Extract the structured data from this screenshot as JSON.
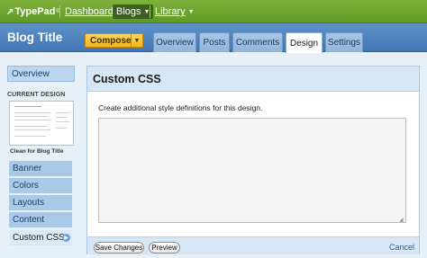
{
  "topbar": {
    "brand": "TypePad",
    "brand_mark": "↗",
    "registered": "®",
    "dashboard": "Dashboard",
    "blogs": "Blogs",
    "library": "Library"
  },
  "header": {
    "blog_title": "Blog Title",
    "compose": "Compose",
    "tabs": [
      "Overview",
      "Posts",
      "Comments",
      "Design",
      "Settings"
    ],
    "active_tab": "Design"
  },
  "sidebar": {
    "overview": "Overview",
    "current_design_label": "CURRENT DESIGN",
    "design_name": "Clean for Blog Title",
    "items": [
      "Banner",
      "Colors",
      "Layouts",
      "Content",
      "Custom CSS"
    ],
    "active_item": "Custom CSS"
  },
  "panel": {
    "title": "Custom CSS",
    "description": "Create additional style definitions for this design.",
    "css_value": "",
    "save_changes": "Save Changes",
    "preview": "Preview",
    "cancel": "Cancel"
  },
  "colors": {
    "topbar_green": "#6aa52c",
    "header_blue": "#4f85c0",
    "compose_yellow": "#f7c52f",
    "sidebar_blue": "#a9c9e8"
  },
  "icons": [
    "caret-down-icon",
    "arrow-right-circle-icon",
    "resize-grip-icon"
  ]
}
